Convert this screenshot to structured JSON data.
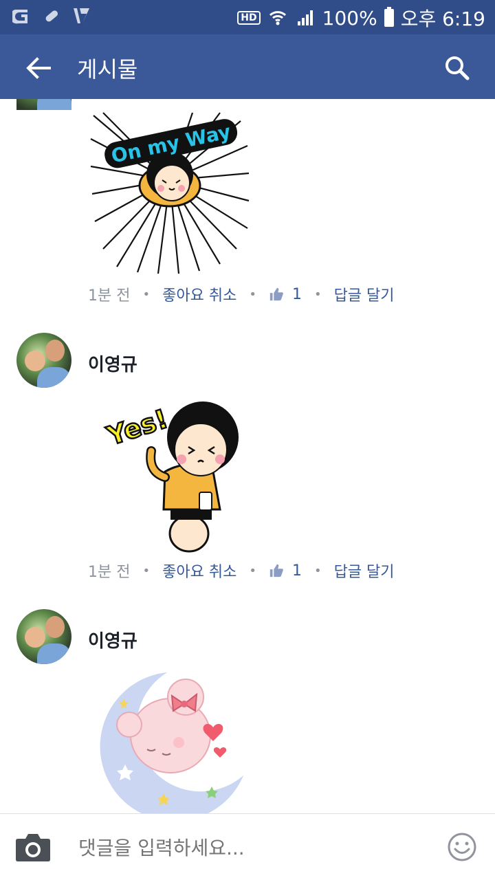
{
  "status_bar": {
    "hd": "HD",
    "battery": "100%",
    "time": "오후 6:19"
  },
  "app_bar": {
    "title": "게시물",
    "back_icon": "arrow-left-icon",
    "search_icon": "search-icon"
  },
  "comments": [
    {
      "author": "",
      "sticker_text": "On my Way",
      "time": "1분 전",
      "unlike_label": "좋아요 취소",
      "like_count": "1",
      "reply_label": "답글 달기"
    },
    {
      "author": "이영규",
      "sticker_text": "Yes!",
      "time": "1분 전",
      "unlike_label": "좋아요 취소",
      "like_count": "1",
      "reply_label": "답글 달기"
    },
    {
      "author": "이영규",
      "sticker_text": "",
      "time": "",
      "unlike_label": "",
      "like_count": "",
      "reply_label": ""
    }
  ],
  "comment_bar": {
    "placeholder": "댓글을 입력하세요...",
    "camera_icon": "camera-icon",
    "emoji_icon": "smiley-icon"
  },
  "colors": {
    "status_bar": "#304c89",
    "app_bar": "#3b5998",
    "link": "#365899",
    "meta": "#8d949e"
  }
}
